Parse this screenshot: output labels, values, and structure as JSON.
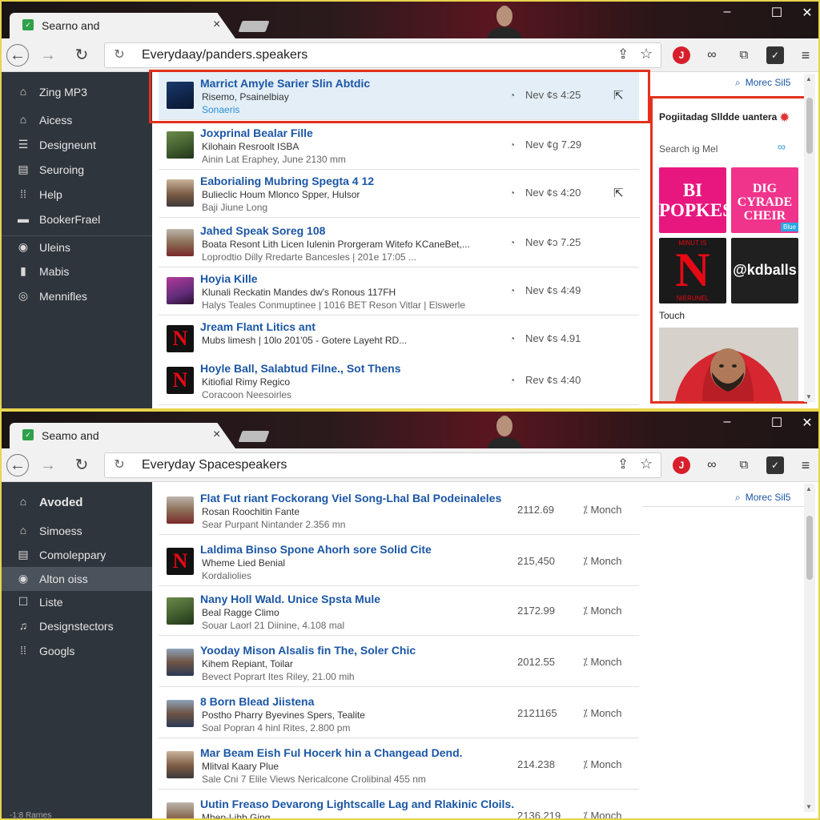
{
  "top": {
    "tab_title": "Searno and",
    "tab_close": "×",
    "window_controls": [
      "–",
      "☐",
      "✕"
    ],
    "address": "Everydaay/panders.speakers",
    "more_label": "Morec Sil5",
    "sidebar": [
      {
        "icon": "home-icon",
        "glyph": "⌂",
        "label": "Zing MP3"
      },
      {
        "icon": "home-icon",
        "glyph": "⌂",
        "label": "Aicess"
      },
      {
        "icon": "list-icon",
        "glyph": "☰",
        "label": "Designeunt"
      },
      {
        "icon": "doc-icon",
        "glyph": "▤",
        "label": "Seuroing"
      },
      {
        "icon": "grid-icon",
        "glyph": "⁞⁞",
        "label": "Help"
      },
      {
        "icon": "bookmark-icon",
        "glyph": "▬",
        "label": "BookerFrael"
      },
      {
        "icon": "circle-icon",
        "glyph": "◉",
        "label": "Uleins"
      },
      {
        "icon": "bag-icon",
        "glyph": "▮",
        "label": "Mabis"
      },
      {
        "icon": "clock-icon",
        "glyph": "◎",
        "label": "Mennifles"
      }
    ],
    "rows": [
      {
        "thumb": "blue",
        "title": "Marrict Amyle Sarier Slin Abtdic",
        "sub": "Risemo, Psainelbiay",
        "sub2": "Sonaeris",
        "date": "Nev ¢s 4:25",
        "cursor": true
      },
      {
        "thumb": "plant",
        "title": "Joxprinal Bealar Fille",
        "sub": "Kilohain Resroolt ISBA",
        "sub2": "Ainin Lat Eraphey, June 2130 mm",
        "date": "Nev ¢g 7.29",
        "cursor": false
      },
      {
        "thumb": "person",
        "title": "Eaborialing Mubring Spegta 4 12",
        "sub": "Bulieclic Houm Mlonco Spper, Hulsor",
        "sub2": "Baji Jiune Long",
        "date": "Nev ¢s 4:20",
        "cursor": true
      },
      {
        "thumb": "person2",
        "title": "Jahed Speak Soreg 108",
        "sub": "Boata Resont Lith Licen Iulenin Prorgeram Witefo KCaneBet,...",
        "sub2": "Loprodtio Dilly Rredarte Bancesles | 201e 17:05 ...",
        "date": "Nev ¢ɔ 7.25",
        "cursor": false
      },
      {
        "thumb": "pink",
        "title": "Hoyia Kille",
        "sub": "Klunali Reckatin Mandes dw's Ronous 117FH",
        "sub2": "Halys Teales Conmuptinee | 1016 BET Reson Vitlar | Elswerle",
        "date": "Nev ¢s 4:49",
        "cursor": false
      },
      {
        "thumb": "netflix",
        "title": "Jream Flant Litics ant",
        "sub": "Mubs limesh | 10lo 201'05 - Gotere Layeht RD...",
        "sub2": "",
        "date": "Nev ¢s 4.91",
        "cursor": false
      },
      {
        "thumb": "netflix",
        "title": "Hoyle Ball, Salabtud Filne., Sot Thens",
        "sub": "Kitiofial Rimy Regico",
        "sub2": "Coracoon Neesoirles",
        "date": "Rev ¢s 4:40",
        "cursor": false
      }
    ],
    "panel": {
      "title": "Pogiitadag Slldde uantera",
      "search": "Search ig Mel",
      "tile1": "BI POPKES",
      "tile2": "DIG CYRADE CHEIR",
      "tile2_badge": "Blue",
      "tile3_top": "MINUT IS",
      "tile3_letter": "N",
      "tile3_bot": "NIERUNEL",
      "tile4": "@kdballs",
      "label": "Touch"
    }
  },
  "bottom": {
    "tab_title": "Seamo and",
    "tab_close": "×",
    "window_controls": [
      "–",
      "☐",
      "✕"
    ],
    "address": "Everyday Spacespeakers",
    "more_label": "Morec Sil5",
    "sidebar": [
      {
        "icon": "home-icon",
        "glyph": "⌂",
        "label": "Avoded"
      },
      {
        "icon": "home-icon",
        "glyph": "⌂",
        "label": "Simoess"
      },
      {
        "icon": "doc-icon",
        "glyph": "▤",
        "label": "Comoleppary"
      },
      {
        "icon": "circle-icon",
        "glyph": "◉",
        "label": "Alton oiss"
      },
      {
        "icon": "list-icon",
        "glyph": "☐",
        "label": "Liste"
      },
      {
        "icon": "music-icon",
        "glyph": "♫",
        "label": "Designstectors"
      },
      {
        "icon": "grid-icon",
        "glyph": "⁞⁞",
        "label": "Googls"
      }
    ],
    "sidebar_foot": "-1:8 Rarnes",
    "rows": [
      {
        "thumb": "person2",
        "title": "Flat Fut riant Fockorang Viel Song-Lhal Bal Podeinaleles",
        "sub": "Rosan Roochitin Fante",
        "sub2": "Sear Purpant Nintander 2.356 mn",
        "num": "2112.69",
        "unit": "Monch"
      },
      {
        "thumb": "netflix",
        "title": "Laldima Binso Spone Ahorh sore Solid Cite",
        "sub": "Wheme Lied Benial",
        "sub2": "Kordaliolies",
        "num": "215,450",
        "unit": "Monch"
      },
      {
        "thumb": "plant",
        "title": "Nany Holl Wald. Unice Spsta Mule",
        "sub": "Beal Ragge Climo",
        "sub2": "Souar Laorl 21 Diinine, 4.108 mal",
        "num": "2172.99",
        "unit": "Monch"
      },
      {
        "thumb": "person3",
        "title": "Yooday Mison Alsalis fin The, Soler Chic",
        "sub": "Kihem Repiant, Toilar",
        "sub2": "Bevect Poprart Ites Riley, 21.00 mih",
        "num": "2012.55",
        "unit": "Monch"
      },
      {
        "thumb": "person3",
        "title": "8 Born Blead Jiistena",
        "sub": "Postho Pharry Byevines Spers, Tealite",
        "sub2": "Soal Popran 4 hinl Rites, 2.800 pm",
        "num": "2121165",
        "unit": "Monch"
      },
      {
        "thumb": "person",
        "title": "Mar Beam Eish Ful Hocerk hin a Changead Dend.",
        "sub": "Mlitval Kaary Plue",
        "sub2": "Sale Cni 7 Elile Views Nericalcone Crolibinal 455 nm",
        "num": "214.238",
        "unit": "Monch"
      },
      {
        "thumb": "person2",
        "title": "Uutin Freaso Devarong Lightscalle Lag and Rlakinic Cloils.",
        "sub": "Mhep-l-ihb Ging",
        "sub2": "",
        "num": "2136.219",
        "unit": "Monch"
      }
    ]
  }
}
